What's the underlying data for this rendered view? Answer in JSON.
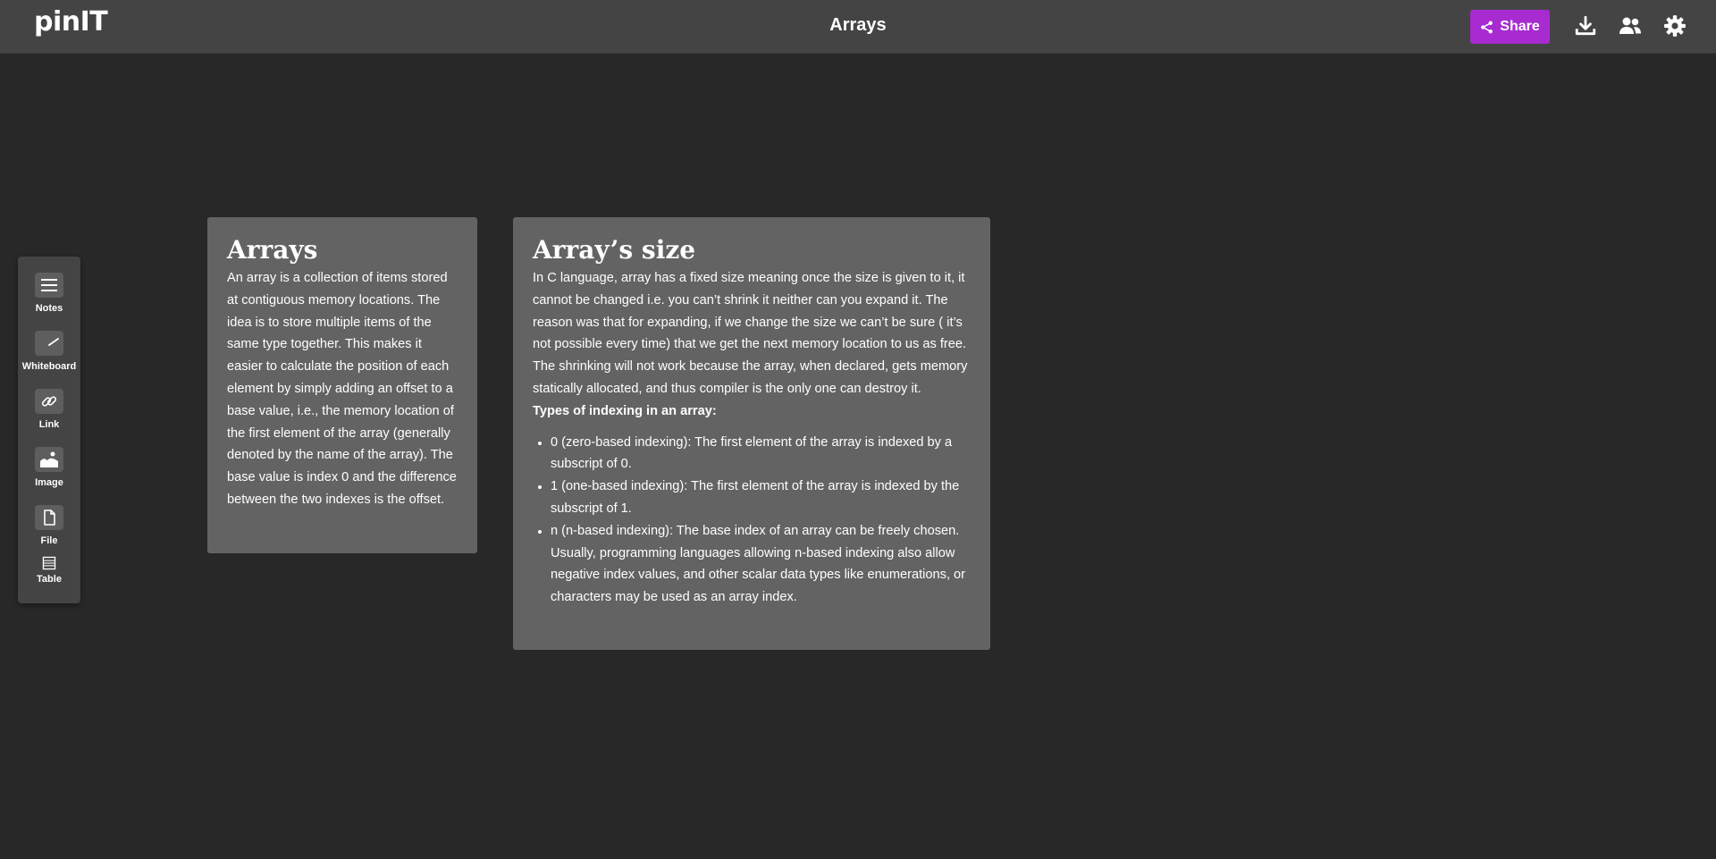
{
  "header": {
    "logo": "pinIT",
    "title": "Arrays",
    "share_label": "Share",
    "icons": [
      "share-icon",
      "download-icon",
      "users-icon",
      "gear-icon"
    ]
  },
  "toolbar": {
    "items": [
      {
        "label": "Notes",
        "icon": "notes-icon"
      },
      {
        "label": "Whiteboard",
        "icon": "whiteboard-icon"
      },
      {
        "label": "Link",
        "icon": "link-icon"
      },
      {
        "label": "Image",
        "icon": "image-icon"
      },
      {
        "label": "File",
        "icon": "file-icon"
      },
      {
        "label": "Table",
        "icon": "table-icon"
      }
    ]
  },
  "cards": [
    {
      "title": "Arrays",
      "body": "An array is a collection of items stored at contiguous memory locations. The idea is to store multiple items of the same type together. This makes it easier to calculate the position of each element by simply adding an offset to a base value, i.e., the memory location of the first element of the array (generally denoted by the name of the array). The base value is index 0 and the difference between the two indexes is the offset."
    },
    {
      "title": "Array’s size",
      "body": "In C language, array has a fixed size meaning once the size is given to it, it cannot be changed i.e. you can’t shrink it neither can you expand it. The reason was that for expanding, if we change the size we can’t be sure ( it’s not possible every time) that we get the next memory location to us as free. The shrinking will not work because the array, when declared, gets memory statically allocated, and thus compiler is the only one can destroy it.",
      "subheading": "Types of indexing in an array:",
      "list": [
        "0 (zero-based indexing): The first element of the array is indexed by a subscript of 0.",
        "1 (one-based indexing): The first element of the array is indexed by the subscript of 1.",
        "n (n-based indexing): The base index of an array can be freely chosen. Usually, programming languages allowing n-based indexing also allow negative index values, and other scalar data types like enumerations, or characters may be used as an array index."
      ]
    }
  ],
  "colors": {
    "background": "#282828",
    "topbar": "#444444",
    "card": "#636363",
    "accent": "#a72bd0"
  }
}
